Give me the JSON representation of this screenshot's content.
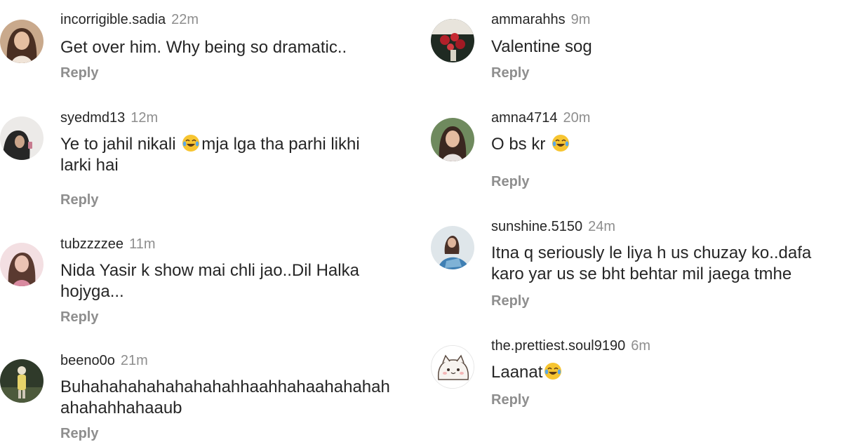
{
  "comments": [
    {
      "username": "incorrigible.sadia",
      "time": "22m",
      "text_before": "Get over him. Why being so dramatic..",
      "emoji": "",
      "text_after": "",
      "reply": "Reply",
      "avatar": "woman-long-hair-avatar"
    },
    {
      "username": "syedmd13",
      "time": "12m",
      "text_before": "Ye to jahil nikali ",
      "emoji": "face-with-tears-of-joy-emoji",
      "text_after": "mja lga tha parhi likhi larki hai",
      "reply": "Reply",
      "avatar": "woman-dark-hair-avatar"
    },
    {
      "username": "tubzzzzee",
      "time": "11m",
      "text_before": "Nida Yasir k show mai chli jao..Dil Halka hojyga...",
      "emoji": "",
      "text_after": "",
      "reply": "Reply",
      "avatar": "woman-pink-avatar"
    },
    {
      "username": "beeno0o",
      "time": "21m",
      "text_before": "Buhahahahahahahahahhaahhahaahahahah ahahahhahaaub",
      "emoji": "",
      "text_after": "",
      "reply": "Reply",
      "avatar": "person-outdoors-avatar"
    },
    {
      "username": "ammarahhs",
      "time": "9m",
      "text_before": "Valentine sog",
      "emoji": "",
      "text_after": "",
      "reply": "Reply",
      "avatar": "roses-avatar"
    },
    {
      "username": "amna4714",
      "time": "20m",
      "text_before": "O bs kr ",
      "emoji": "face-with-tears-of-joy-emoji",
      "text_after": "",
      "reply": "Reply",
      "avatar": "woman-portrait-avatar"
    },
    {
      "username": "sunshine.5150",
      "time": "24m",
      "text_before": "Itna q seriously le liya h us chuzay ko..dafa karo yar us se bht behtar mil jaega tmhe",
      "emoji": "",
      "text_after": "",
      "reply": "Reply",
      "avatar": "woman-blue-dress-avatar"
    },
    {
      "username": "the.prettiest.soul9190",
      "time": "6m",
      "text_before": "Laanat",
      "emoji": "face-with-tears-of-joy-emoji",
      "text_after": "",
      "reply": "Reply",
      "avatar": "cartoon-cat-avatar"
    }
  ],
  "colors": {
    "username": "#262626",
    "meta": "#8e8e8e",
    "background": "#ffffff"
  }
}
